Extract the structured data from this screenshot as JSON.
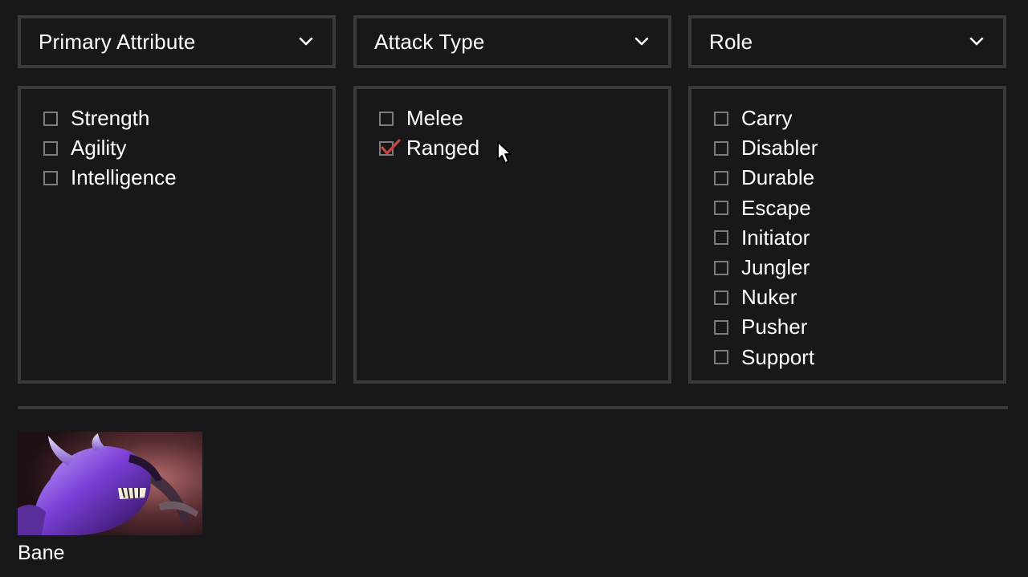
{
  "filters": {
    "primary_attribute": {
      "label": "Primary Attribute",
      "options": [
        {
          "label": "Strength",
          "checked": false
        },
        {
          "label": "Agility",
          "checked": false
        },
        {
          "label": "Intelligence",
          "checked": false
        }
      ]
    },
    "attack_type": {
      "label": "Attack Type",
      "options": [
        {
          "label": "Melee",
          "checked": false
        },
        {
          "label": "Ranged",
          "checked": true
        }
      ]
    },
    "role": {
      "label": "Role",
      "options": [
        {
          "label": "Carry",
          "checked": false
        },
        {
          "label": "Disabler",
          "checked": false
        },
        {
          "label": "Durable",
          "checked": false
        },
        {
          "label": "Escape",
          "checked": false
        },
        {
          "label": "Initiator",
          "checked": false
        },
        {
          "label": "Jungler",
          "checked": false
        },
        {
          "label": "Nuker",
          "checked": false
        },
        {
          "label": "Pusher",
          "checked": false
        },
        {
          "label": "Support",
          "checked": false
        }
      ]
    }
  },
  "results": [
    {
      "name": "Bane"
    }
  ],
  "icons": {
    "dropdown": "chevron-down-icon",
    "checkbox_checked": "checkmark-icon",
    "cursor": "mouse-pointer-icon"
  },
  "colors": {
    "background": "#18171a",
    "border": "#3a393c",
    "text": "#ffffff",
    "checkbox_border": "#7d7c80",
    "check_accent": "#c9463d"
  }
}
